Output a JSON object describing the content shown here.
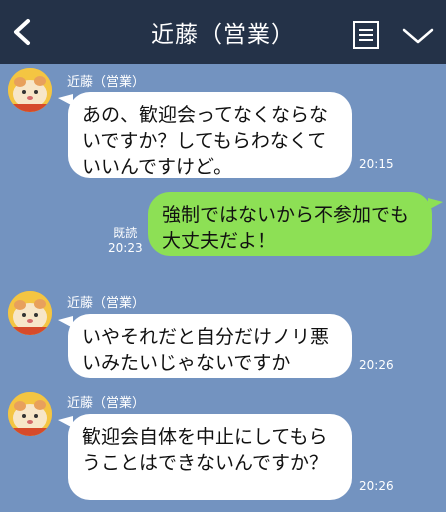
{
  "header": {
    "title": "近藤（営業）"
  },
  "messages": [
    {
      "sender": "近藤（営業）",
      "text": "あの、歓迎会ってなくならないですか？してもらわなくていいんですけど。",
      "time": "20:15"
    },
    {
      "sender": "me",
      "text": "強制ではないから不参加でも大丈夫だよ！",
      "read_label": "既読",
      "time": "20:23"
    },
    {
      "sender": "近藤（営業）",
      "text": "いやそれだと自分だけノリ悪いみたいじゃないですか",
      "time": "20:26"
    },
    {
      "sender": "近藤（営業）",
      "text": "歓迎会自体を中止にしてもらうことはできないんですか？",
      "time": "20:26"
    }
  ],
  "colors": {
    "header_bg": "#243248",
    "chat_bg": "#7393c0",
    "incoming_bubble": "#ffffff",
    "outgoing_bubble": "#8de055"
  },
  "icons": {
    "back": "chevron-left-icon",
    "menu": "list-menu-icon",
    "more": "chevron-down-icon"
  }
}
